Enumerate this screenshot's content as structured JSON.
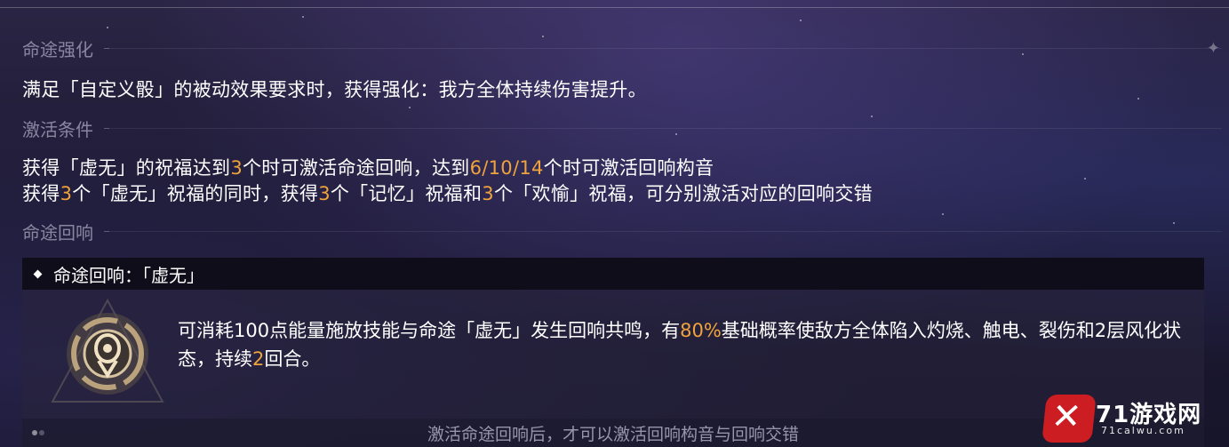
{
  "sections": {
    "enhance": {
      "label": "命途强化",
      "text": "满足「自定义骰」的被动效果要求时，获得强化：我方全体持续伤害提升。"
    },
    "activation": {
      "label": "激活条件",
      "line1": {
        "a": "获得「虚无」的祝福达到",
        "b": "3",
        "c": "个时可激活命途回响，达到",
        "d": "6/10/14",
        "e": "个时可激活回响构音"
      },
      "line2": {
        "a": "获得",
        "b": "3",
        "c": "个「虚无」祝福的同时，获得",
        "d": "3",
        "e": "个「记忆」祝福和",
        "f": "3",
        "g": "个「欢愉」祝福，可分别激活对应的回响交错"
      }
    },
    "echo": {
      "label": "命途回响",
      "header_title": "命途回响：「虚无」",
      "desc": {
        "a": "可消耗100点能量施放技能与命途「虚无」发生回响共鸣，有",
        "b": "80%",
        "c": "基础概率使敌方全体陷入灼烧、触电、裂伤和2层风化状态，持续",
        "d": "2",
        "e": "回合。"
      }
    }
  },
  "footer": {
    "note": "激活命途回响后，才可以激活回响构音与回响交错"
  },
  "watermark": {
    "brand": "71游戏网",
    "url": "71calwu.com"
  },
  "colors": {
    "highlight": "#f0a33c",
    "label": "#8a86a0",
    "text": "#ffffff"
  },
  "icons": {
    "emblem": "nihility-path-emblem-icon",
    "header_marker": "diamond-icon"
  }
}
